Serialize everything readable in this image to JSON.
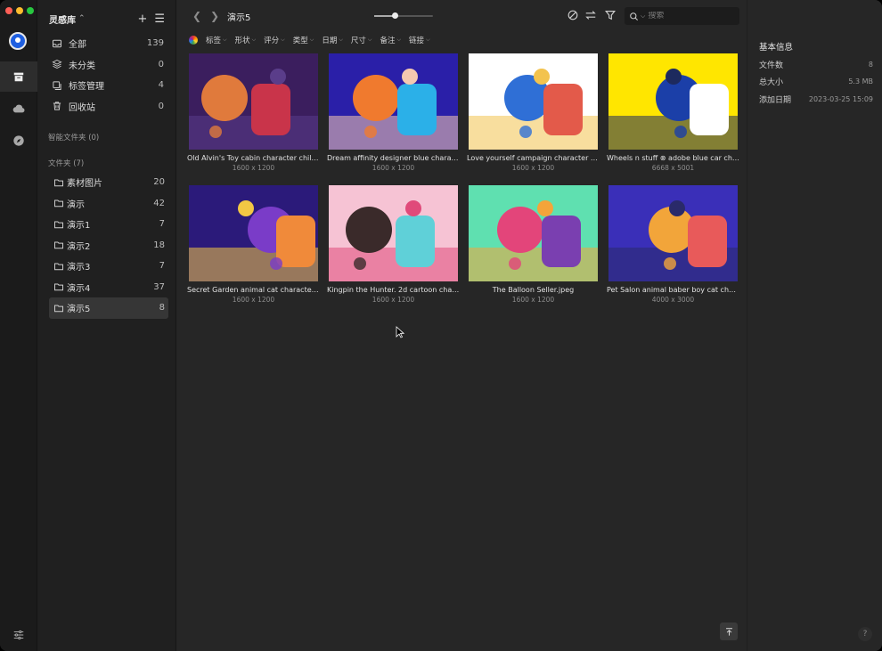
{
  "colors": {
    "window_bg": "#262626",
    "sidebar_bg": "#202020",
    "rail_bg": "#1b1b1b",
    "selected_bg": "#363636",
    "accent_logo": "#1f5fe0"
  },
  "rail": {
    "items": [
      {
        "name": "library-logo-icon"
      },
      {
        "name": "archive-box-icon",
        "active": true
      },
      {
        "name": "cloud-upload-icon"
      },
      {
        "name": "compass-icon"
      }
    ],
    "bottom_icon": "sliders-icon"
  },
  "sidebar": {
    "library_title": "灵感库",
    "nav": [
      {
        "label": "全部",
        "count": "139",
        "icon": "inbox-icon"
      },
      {
        "label": "未分类",
        "count": "0",
        "icon": "layers-icon"
      },
      {
        "label": "标签管理",
        "count": "4",
        "icon": "tag-manage-icon"
      },
      {
        "label": "回收站",
        "count": "0",
        "icon": "trash-icon"
      }
    ],
    "smart_folders_label": "智能文件夹 (0)",
    "folders_label": "文件夹 (7)",
    "folders": [
      {
        "label": "素材图片",
        "count": "20"
      },
      {
        "label": "演示",
        "count": "42"
      },
      {
        "label": "演示1",
        "count": "7"
      },
      {
        "label": "演示2",
        "count": "18"
      },
      {
        "label": "演示3",
        "count": "7"
      },
      {
        "label": "演示4",
        "count": "37"
      },
      {
        "label": "演示5",
        "count": "8",
        "selected": true
      }
    ]
  },
  "toolbar": {
    "title": "演示5",
    "zoom_level": 0.35,
    "search_placeholder": "搜索"
  },
  "filters": [
    "标签",
    "形状",
    "评分",
    "类型",
    "日期",
    "尺寸",
    "备注",
    "链接"
  ],
  "items": [
    {
      "name": "Old Alvin's Toy cabin character child ...",
      "dims": "1600 x 1200",
      "palette": [
        "#3b1e5e",
        "#e07a3c",
        "#c9344a",
        "#5a3d8a"
      ]
    },
    {
      "name": "Dream affinity designer blue characte...",
      "dims": "1600 x 1200",
      "palette": [
        "#2a1fa8",
        "#f07a2e",
        "#2bb0e8",
        "#f5c9b0"
      ]
    },
    {
      "name": "Love yourself campaign character con...",
      "dims": "1600 x 1200",
      "palette": [
        "#ffffff",
        "#2f6fd6",
        "#e35a4a",
        "#f3c34e"
      ]
    },
    {
      "name": "Wheels n stuff ⊗ adobe blue car char...",
      "dims": "6668 x 5001",
      "palette": [
        "#ffe600",
        "#1b3fa8",
        "#ffffff",
        "#1d2a5e"
      ]
    },
    {
      "name": "Secret Garden animal cat character c...",
      "dims": "1600 x 1200",
      "palette": [
        "#2b1a7a",
        "#7a3cc8",
        "#f08a3a",
        "#f2c744"
      ]
    },
    {
      "name": "Kingpin the Hunter. 2d cartoon chara...",
      "dims": "1600 x 1200",
      "palette": [
        "#f6c3d4",
        "#3a2a2a",
        "#5fd0d8",
        "#e04a7a"
      ]
    },
    {
      "name": "The Balloon Seller.jpeg",
      "dims": "1600 x 1200",
      "palette": [
        "#5fe0b0",
        "#e3457a",
        "#7a3fb0",
        "#f4a43a"
      ]
    },
    {
      "name": "Pet Salon animal baber boy cat chara...",
      "dims": "4000 x 3000",
      "palette": [
        "#3a2fb8",
        "#f2a53a",
        "#e85a5a",
        "#2a2a6a"
      ]
    }
  ],
  "inspector": {
    "title": "基本信息",
    "rows": [
      {
        "key": "文件数",
        "value": "8"
      },
      {
        "key": "总大小",
        "value": "5.3 MB"
      },
      {
        "key": "添加日期",
        "value": "2023-03-25 15:09"
      }
    ]
  },
  "help_label": "?"
}
